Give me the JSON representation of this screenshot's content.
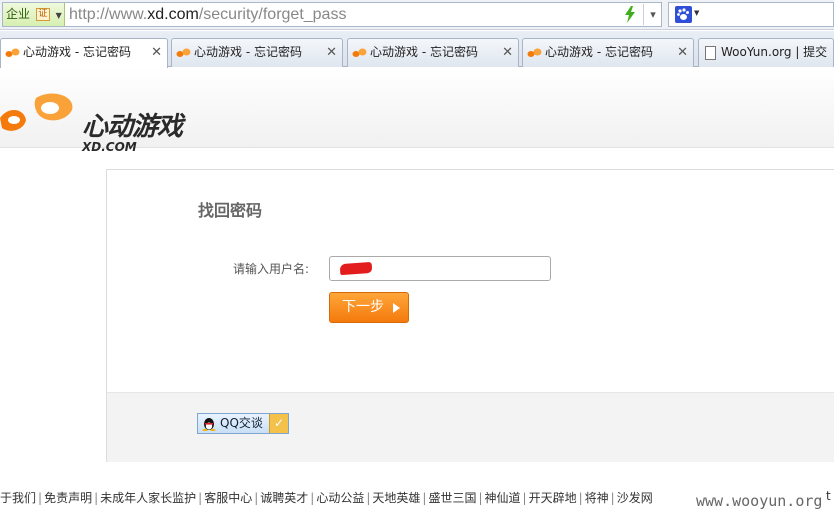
{
  "browser": {
    "org_badge": "企业",
    "cert_badge": "证",
    "url_prefix": "http://www.",
    "url_host": "xd.com",
    "url_path": "/security/forget_pass",
    "tabs": [
      {
        "label": "心动游戏 - 忘记密码",
        "active": true
      },
      {
        "label": "心动游戏 - 忘记密码",
        "active": false
      },
      {
        "label": "心动游戏 - 忘记密码",
        "active": false
      },
      {
        "label": "心动游戏 - 忘记密码",
        "active": false
      },
      {
        "label": "WooYun.org | 提交",
        "active": false
      }
    ],
    "close_glyph": "✕"
  },
  "header": {
    "logo_cn": "心动游戏",
    "logo_en": "XD.COM"
  },
  "form": {
    "title": "找回密码",
    "username_label": "请输入用户名:",
    "next_label": "下一步"
  },
  "support": {
    "qq_label": "QQ交谈"
  },
  "footer": {
    "links": [
      "于我们",
      "免责声明",
      "未成年人家长监护",
      "客服中心",
      "诚聘英才",
      "心动公益",
      "天地英雄",
      "盛世三国",
      "神仙道",
      "开天辟地",
      "将神",
      "沙发网"
    ],
    "separator": "|",
    "watermark": "www.wooyun.org",
    "edge_char": "t"
  },
  "colors": {
    "accent_orange": "#f47a0c",
    "redaction": "#e31d1d"
  }
}
